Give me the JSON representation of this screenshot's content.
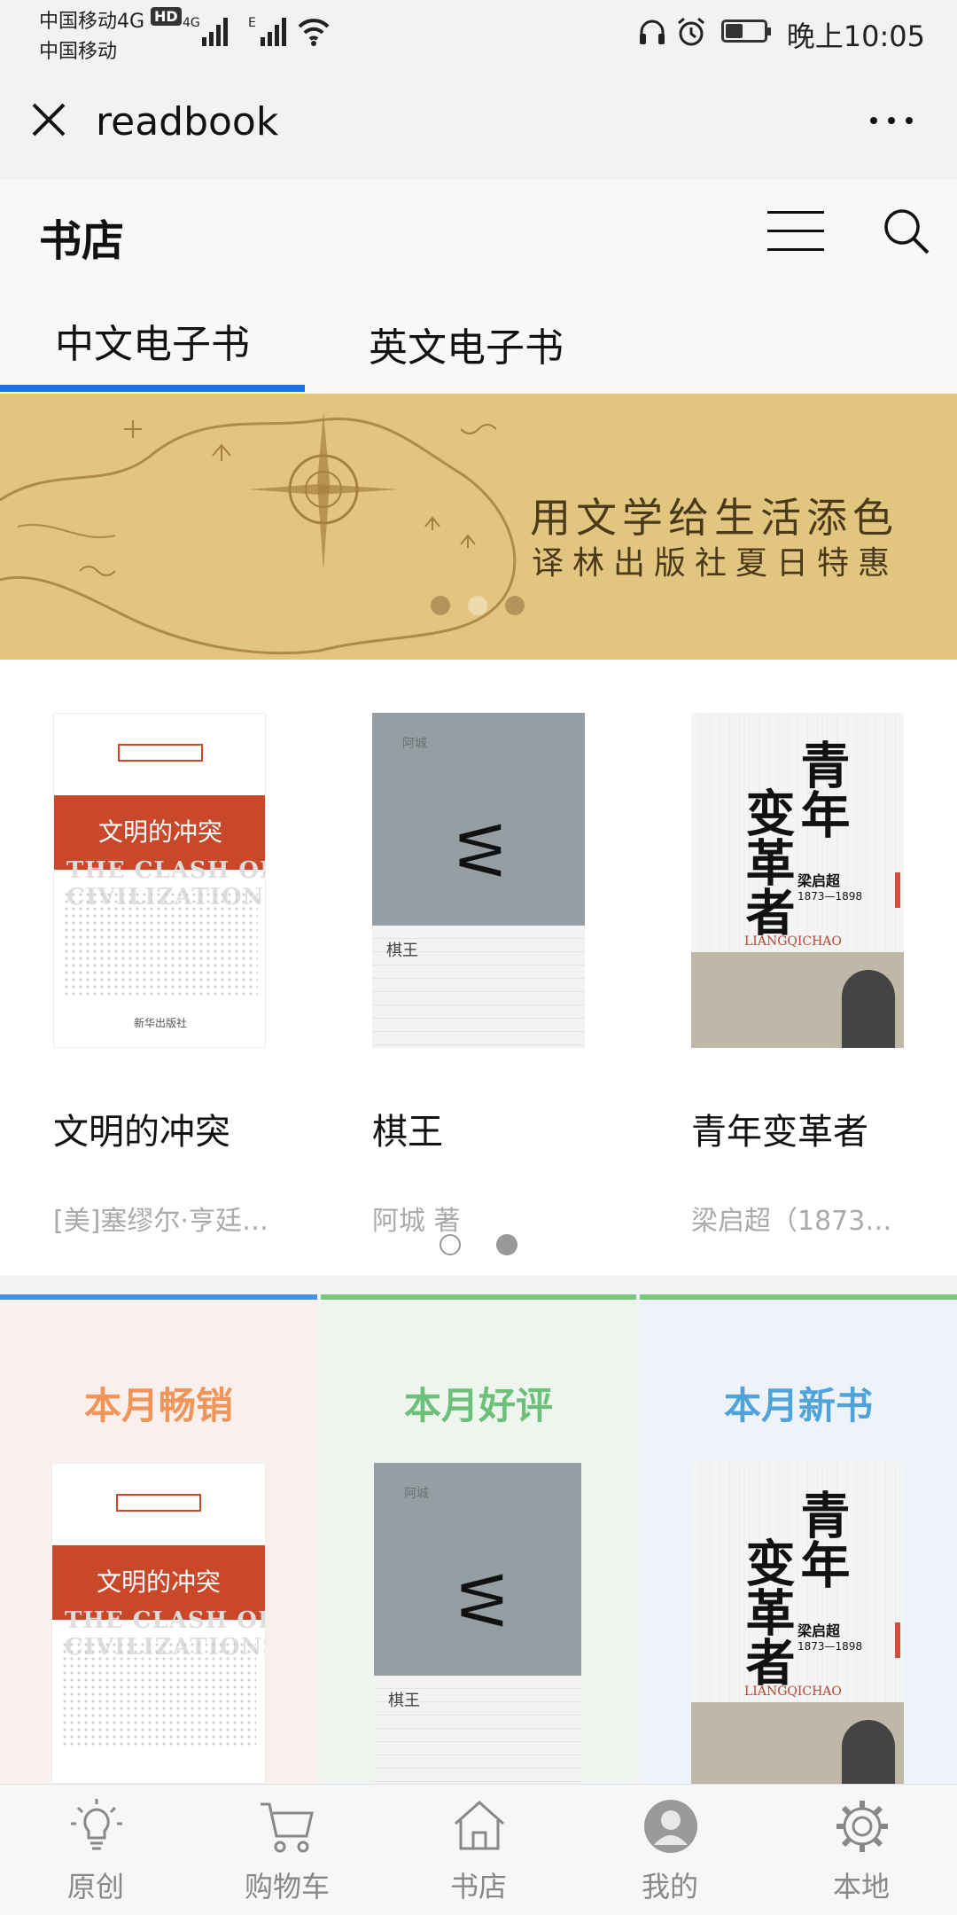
{
  "status_bar": {
    "carrier_line1": "中国移动4G",
    "hd_badge": "HD",
    "carrier_line2": "中国移动",
    "network1": "4G",
    "network2": "E",
    "time": "晚上10:05",
    "battery_level": 0.45
  },
  "title_bar": {
    "title": "readbook"
  },
  "store": {
    "title": "书店",
    "tabs": [
      "中文电子书",
      "英文电子书"
    ],
    "active_tab": 0
  },
  "banner": {
    "line1": "用文学给生活添色",
    "line2": "译林出版社夏日特惠",
    "slide_count": 3,
    "active_slide": 1
  },
  "featured": {
    "books": [
      {
        "title": "文明的冲突",
        "author": "[美]塞缪尔·亨廷…",
        "cover": {
          "band_text": "文明的冲突",
          "subtitle": "THE CLASH OF CIVILIZATIONS",
          "publisher": "新华出版社"
        }
      },
      {
        "title": "棋王",
        "author": "阿城 著",
        "cover": {
          "small_text": "阿城",
          "name": "棋王"
        }
      },
      {
        "title": "青年变革者",
        "author": "梁启超（1873…",
        "cover": {
          "chars_left": "变革者",
          "chars_right": "青年",
          "name": "梁启超",
          "years": "1873—1898",
          "en": "LIANGQICHAO"
        }
      }
    ],
    "page_count": 2,
    "active_page": 1
  },
  "categories": [
    {
      "label": "本月畅销",
      "color": "#f0955a",
      "bg": "#f9f0ee",
      "top": "#4a90e2"
    },
    {
      "label": "本月好评",
      "color": "#6cc07a",
      "bg": "#eef5ee",
      "top": "#7ac77d"
    },
    {
      "label": "本月新书",
      "color": "#4fa3db",
      "bg": "#eef2f9",
      "top": "#7ac77d"
    }
  ],
  "bottom_nav": [
    {
      "label": "原创",
      "icon": "lightbulb-icon"
    },
    {
      "label": "购物车",
      "icon": "cart-icon"
    },
    {
      "label": "书店",
      "icon": "home-icon"
    },
    {
      "label": "我的",
      "icon": "user-icon"
    },
    {
      "label": "本地",
      "icon": "gear-icon"
    }
  ]
}
